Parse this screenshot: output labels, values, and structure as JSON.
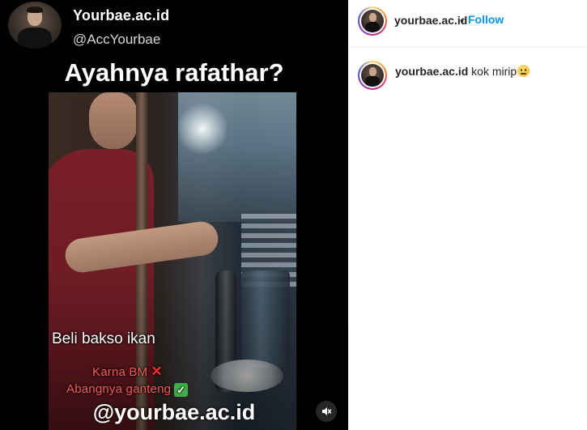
{
  "post": {
    "author_name": "Yourbae.ac.id",
    "author_handle": "@AccYourbae",
    "title": "Ayahnya rafathar?",
    "caption_main": "Beli bakso ikan",
    "caption_reason_1": "Karna BM",
    "caption_reason_2": "Abangnya ganteng",
    "watermark": "@yourbae.ac.id",
    "mark_cross": "✕",
    "mark_check": "✓"
  },
  "sidebar": {
    "username": "yourbae.ac.id",
    "separator": "•",
    "follow_label": "Follow",
    "comment": {
      "username": "yourbae.ac.id",
      "text": "kok mirip"
    }
  },
  "icons": {
    "mute": "speaker-muted-icon",
    "emoji": "slightly-smiling-face-emoji"
  },
  "colors": {
    "follow": "#0095f6",
    "caption_red": "#ff5a56",
    "check_green": "#3fae48"
  }
}
